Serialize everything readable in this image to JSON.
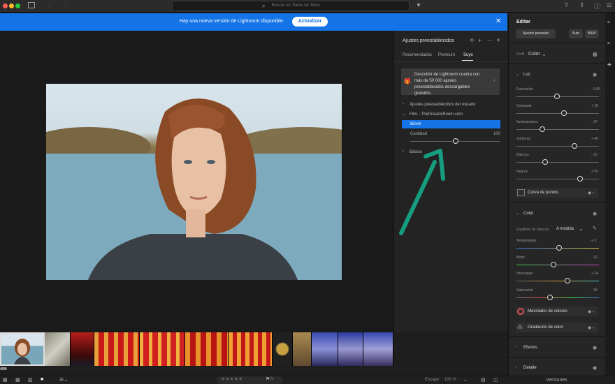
{
  "window": {
    "search_placeholder": "Buscar en Todas las fotos"
  },
  "banner": {
    "message": "Hay una nueva versión de Lightroom disponible.",
    "button": "Actualizar"
  },
  "presets": {
    "title": "Ajustes preestablecidos",
    "tabs": [
      "Recomendados",
      "Premium",
      "Suyo"
    ],
    "promo": "Descubrir de Lightroom cuenta con más de 50 000 ajustes preestablecidos descargables gratuitos.",
    "group_user": "Ajustes preestablecidos del usuario",
    "group_film": "Film - ThePresetsRoom.com",
    "selected": "35mm",
    "amount_value": "100",
    "group_basic": "Básico"
  },
  "edit": {
    "title": "Editar",
    "presets_btn": "Ajustes preestab",
    "auto": "Auto",
    "bw": "B&W",
    "profile_label": "Perfil",
    "profile_value": "Color",
    "light": {
      "title": "Luz",
      "sliders": [
        {
          "label": "Exposición",
          "value": "- 0,06"
        },
        {
          "label": "Contraste",
          "value": "+ 15"
        },
        {
          "label": "Iluminaciones",
          "value": "- 37"
        },
        {
          "label": "Sombras",
          "value": "+ 40"
        },
        {
          "label": "Blancos",
          "value": "- 30"
        },
        {
          "label": "Negros",
          "value": "+ 55"
        }
      ],
      "curve": "Curva de puntos"
    },
    "color": {
      "title": "Color",
      "wb_label": "Equilibrio de blancos",
      "wb_value": "A medida",
      "sliders": [
        {
          "label": "Temperatura",
          "value": "+ 3"
        },
        {
          "label": "Matiz",
          "value": "- 10"
        },
        {
          "label": "Intensidad",
          "value": "+ 24"
        },
        {
          "label": "Saturación",
          "value": "- 18"
        }
      ],
      "mixer": "Mezclador de colores",
      "grading": "Gradación de color"
    },
    "effects": "Efectos",
    "detail": "Detalle",
    "versions": "Versiones"
  },
  "bottom": {
    "fit": "Encajar",
    "zoom": "100 %"
  }
}
